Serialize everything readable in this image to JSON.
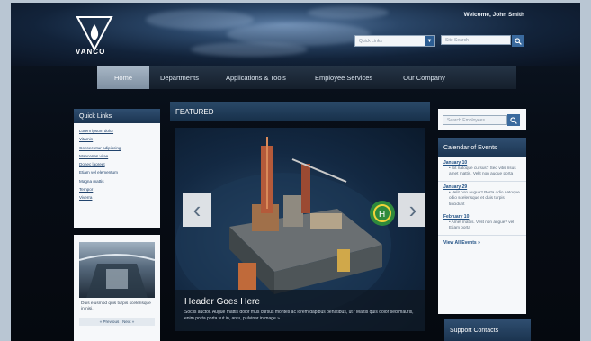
{
  "header": {
    "brand": "VANCO",
    "welcome": "Welcome, John Smith",
    "quicklinks_placeholder": "Quick Links",
    "search_placeholder": "Site Search"
  },
  "nav": {
    "items": [
      {
        "label": "Home",
        "active": true
      },
      {
        "label": "Departments"
      },
      {
        "label": "Applications & Tools"
      },
      {
        "label": "Employee Services"
      },
      {
        "label": "Our Company"
      }
    ]
  },
  "quick_links": {
    "title": "Quick Links",
    "links": [
      "Lorem ipsum dolor",
      "Vitamin",
      "Consectetur adipiscing",
      "Maecenas vitae",
      "Donec laoreet",
      "Etiam vel elementum",
      "Magna mattis",
      "Tempor",
      "Viverra"
    ]
  },
  "thumbnail": {
    "caption": "Duis eiusmod quis turpis scelerisque in nisi.",
    "pager": "« Previous | Next »"
  },
  "featured": {
    "title": "FEATURED",
    "caption_title": "Header Goes Here",
    "caption_text": "Sociis auctor. Augue mattis dolor mus cursus montes ac lorem dapibus penatibus, ut? Mattis quis dolor sed mauris, enim porta porta vut in, arcu, pulvinar in mage »"
  },
  "sidebar": {
    "search_placeholder": "Search Employees",
    "calendar_title": "Calendar of Events",
    "events": [
      {
        "date": "January 10",
        "desc": "• Sit natoque cursus? Sed vitis risus amet mattis. Velit non augue porta"
      },
      {
        "date": "January 29",
        "desc": "• Velit non augue? Porta odio natoque odio scelerisque et duis turpis tincidunt"
      },
      {
        "date": "February 10",
        "desc": "• Amet mattis. Velit non augue? vel Etiam porta"
      }
    ],
    "view_all": "View All Events »",
    "support_title": "Support Contacts"
  }
}
